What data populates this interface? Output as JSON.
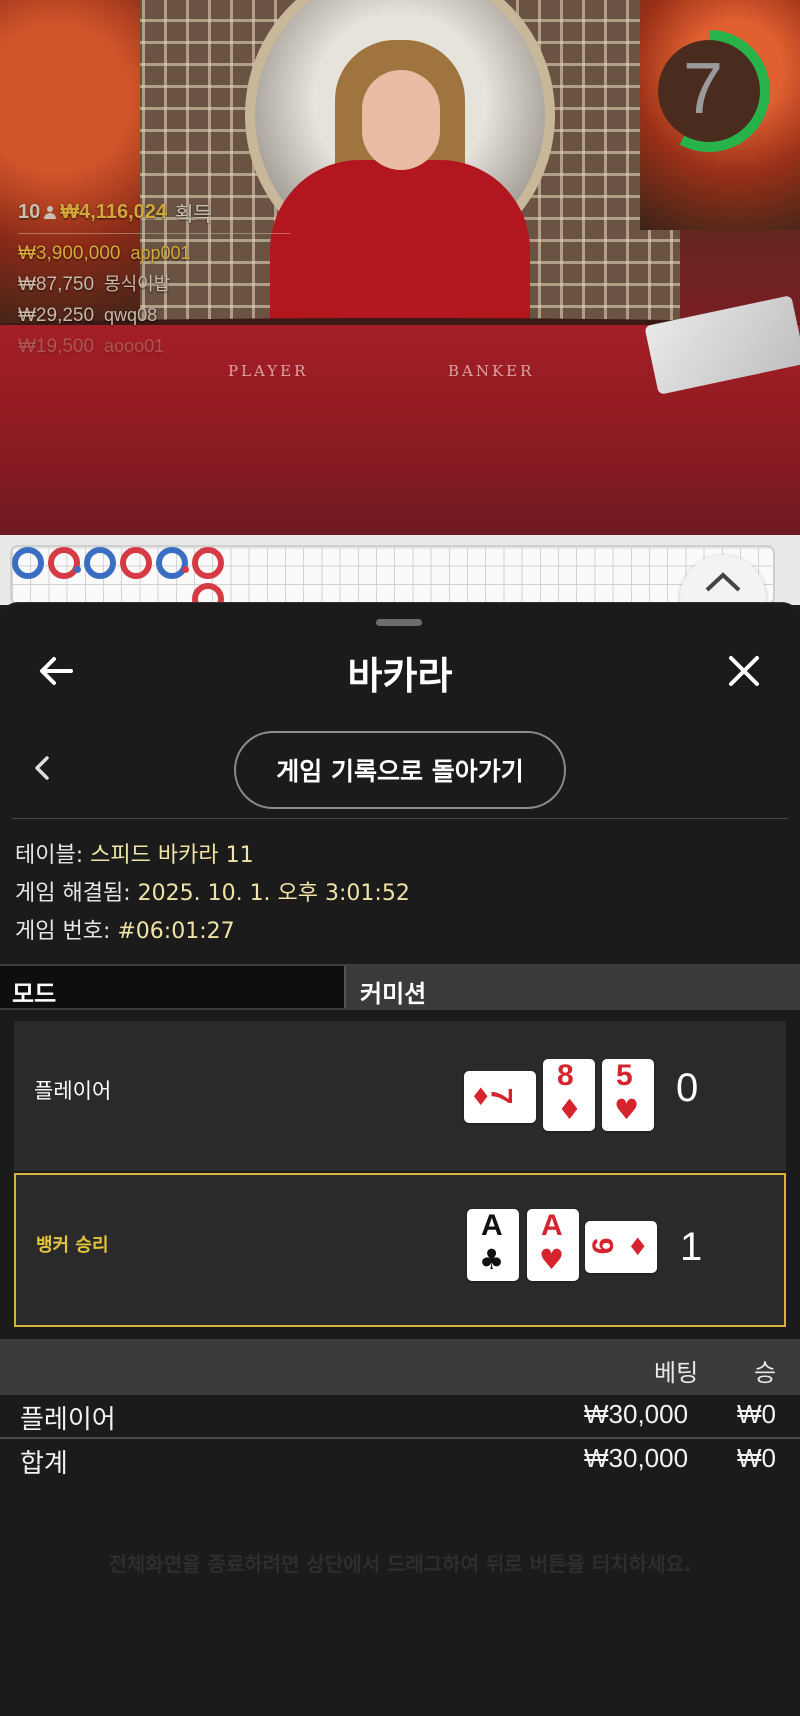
{
  "video": {
    "timer": "7",
    "timer_fraction": 0.58,
    "timer_color": "#27b24a",
    "felt_labels": [
      "PLAYER",
      "BANKER"
    ],
    "winners": {
      "count": "10",
      "total": "₩4,116,024",
      "label": "획득",
      "rows": [
        {
          "amount": "₩3,900,000",
          "name": "app001"
        },
        {
          "amount": "₩87,750",
          "name": "몽식이밥"
        },
        {
          "amount": "₩29,250",
          "name": "qwq08"
        },
        {
          "amount": "₩19,500",
          "name": "aooo01"
        }
      ]
    }
  },
  "roadmap": {
    "colors": {
      "player": "#3a6ec2",
      "banker": "#d63a44"
    },
    "icon": "chevron-up-icon"
  },
  "sheet": {
    "title": "바카라",
    "back_icon": "arrow-left-icon",
    "close_icon": "close-icon",
    "prev_icon": "chevron-left-icon",
    "return_button": "게임 기록으로 돌아가기",
    "info": {
      "table_label": "테이블:",
      "table_value": "스피드 바카라 11",
      "resolved_label": "게임 해결됨:",
      "resolved_value": "2025. 10. 1. 오후 3:01:52",
      "number_label": "게임 번호:",
      "number_value": "#06:01:27"
    },
    "columns": [
      "모드",
      "커미션"
    ],
    "player": {
      "label": "플레이어",
      "score": "0",
      "cards": [
        {
          "rank": "7",
          "suit": "♦",
          "color": "red",
          "rotated": true
        },
        {
          "rank": "8",
          "suit": "♦",
          "color": "red",
          "rotated": false
        },
        {
          "rank": "5",
          "suit": "♥",
          "color": "red",
          "rotated": false
        }
      ]
    },
    "banker": {
      "label": "뱅커 승리",
      "score": "1",
      "accent": "#d6b43a",
      "cards": [
        {
          "rank": "A",
          "suit": "♣",
          "color": "black",
          "rotated": false
        },
        {
          "rank": "A",
          "suit": "♥",
          "color": "red",
          "rotated": false
        },
        {
          "rank": "9",
          "suit": "♦",
          "color": "red",
          "rotated": true
        }
      ]
    },
    "bets": {
      "headers": {
        "bet": "베팅",
        "win": "승"
      },
      "rows": [
        {
          "name": "플레이어",
          "bet": "₩30,000",
          "win": "₩0"
        },
        {
          "name": "합계",
          "bet": "₩30,000",
          "win": "₩0"
        }
      ]
    },
    "hint": "전체화면을 종료하려면 상단에서 드래그하여 뒤로 버튼을 터치하세요."
  }
}
